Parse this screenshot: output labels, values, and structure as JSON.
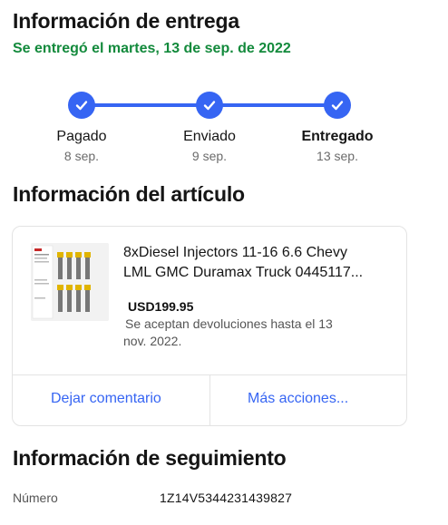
{
  "delivery": {
    "heading": "Información de entrega",
    "status": "Se entregó el martes, 13 de sep. de 2022",
    "steps": [
      {
        "label": "Pagado",
        "date": "8 sep.",
        "done": true
      },
      {
        "label": "Enviado",
        "date": "9 sep.",
        "done": true
      },
      {
        "label": "Entregado",
        "date": "13 sep.",
        "done": true
      }
    ]
  },
  "item": {
    "heading": "Información del artículo",
    "thumbnail_icon": "product-image",
    "title_line1": "8xDiesel Injectors 11-16 6.6 Chevy",
    "title_line2": "LML GMC Duramax Truck 0445117...",
    "price": "USD199.95",
    "returns_line1": "Se aceptan devoluciones hasta el 13",
    "returns_line2": "nov. 2022.",
    "actions": {
      "feedback": "Dejar comentario",
      "more": "Más acciones..."
    }
  },
  "tracking": {
    "heading": "Información de seguimiento",
    "number_label": "Número",
    "number_value": "1Z14V5344231439827"
  },
  "colors": {
    "accent": "#3665f3",
    "success": "#138a3c"
  }
}
